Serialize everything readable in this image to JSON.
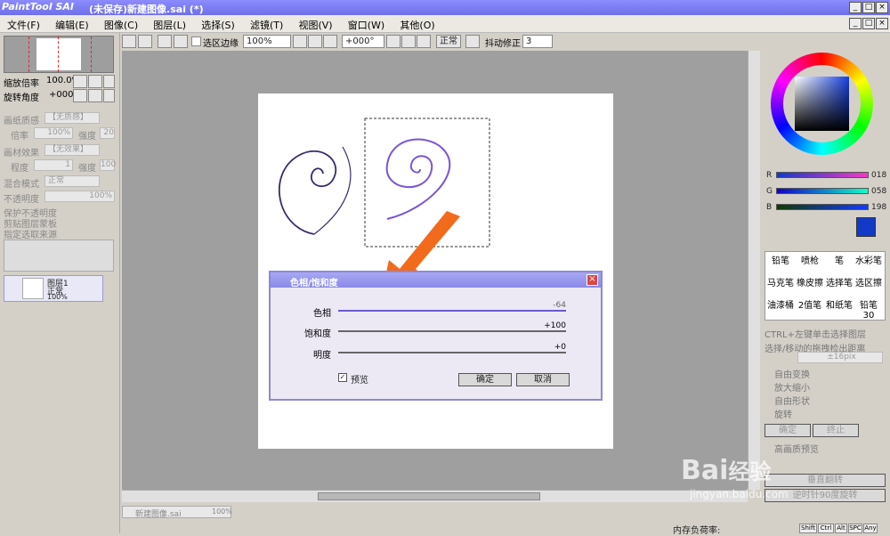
{
  "window": {
    "logo": "PaintTool SAI",
    "title": "(未保存)新建图像.sai (*)"
  },
  "menu": [
    "文件(F)",
    "编辑(E)",
    "图像(C)",
    "图层(L)",
    "选择(S)",
    "滤镜(T)",
    "视图(V)",
    "窗口(W)",
    "其他(O)"
  ],
  "toolbar": {
    "selection_edge_label": "选区边缘",
    "zoom": "100%",
    "rotation": "+000°",
    "blend_mode": "正常",
    "stabilizer_label": "抖动修正",
    "stabilizer_value": "3"
  },
  "navigator": {
    "zoom_label": "缩放倍率",
    "zoom_value": "100.0%",
    "angle_label": "旋转角度",
    "angle_value": "+000"
  },
  "texture": {
    "paper_label": "画纸质感",
    "paper_value": "【无质感】",
    "scale_label": "倍率",
    "scale_value": "100%",
    "strength_label": "强度",
    "strength_value": "20",
    "effect_label": "画材效果",
    "effect_value": "【无效果】",
    "degree_label": "程度",
    "degree_value": "1",
    "strength2_value": "100"
  },
  "layer_props": {
    "blend_label": "混合模式",
    "blend_value": "正常",
    "opacity_label": "不透明度",
    "opacity_value": "100%",
    "opt1": "保护不透明度",
    "opt2": "剪贴图层蒙板",
    "opt3": "指定选取来源"
  },
  "layer": {
    "name": "图层1",
    "mode": "正常",
    "opacity": "100%"
  },
  "document_tab": {
    "name": "新建图像.sai",
    "zoom": "100%"
  },
  "color": {
    "r_label": "R",
    "g_label": "G",
    "b_label": "B",
    "r": "018",
    "g": "058",
    "b": "198",
    "current": "#123ac6"
  },
  "tools": [
    "铅笔",
    "喷枪",
    "笔",
    "水彩笔",
    "马克笔",
    "橡皮擦",
    "选择笔",
    "选区擦",
    "油漆桶",
    "2值笔",
    "和纸笔",
    "铅笔30"
  ],
  "transform": {
    "ctrl_hint": "CTRL+左键单击选择图层",
    "drag_label": "选择/移动的拖拽检出距离",
    "drag_value": "±16pix",
    "opts": [
      "自由变换",
      "放大缩小",
      "自由形状",
      "旋转"
    ],
    "ok": "确定",
    "cancel": "终止",
    "hq_preview": "高画质预览",
    "flip_h": "垂直翻转",
    "rotate_ccw": "逆时针90度旋转"
  },
  "dialog": {
    "title": "色相/饱和度",
    "hue_label": "色相",
    "hue_value": "-64",
    "sat_label": "饱和度",
    "sat_value": "+100",
    "light_label": "明度",
    "light_value": "+0",
    "preview_label": "预览",
    "ok_label": "确定",
    "cancel_label": "取消"
  },
  "status": {
    "memory_label": "内存负荷率:",
    "keys": [
      "Shift",
      "Ctrl",
      "Alt",
      "SPC",
      "Any"
    ]
  },
  "watermark": {
    "brand": "Bai",
    "brand2": "经验",
    "url": "jingyan.baidu.com"
  }
}
